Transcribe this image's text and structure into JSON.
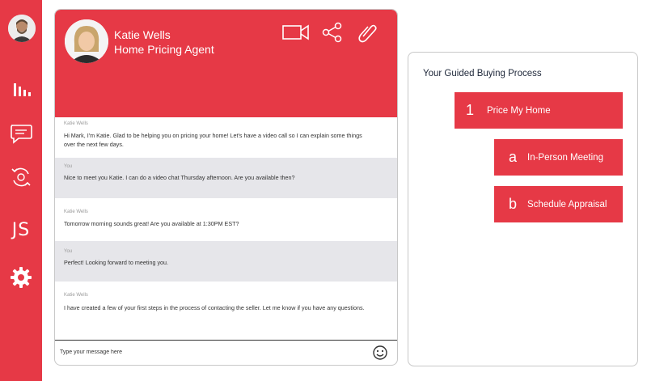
{
  "sidebar": {
    "nav": [
      "analytics-icon",
      "chat-icon",
      "sync-icon",
      "profile-initials",
      "gear-icon"
    ],
    "initials": "JS"
  },
  "chat": {
    "agent": {
      "name": "Katie Wells",
      "title": "Home Pricing Agent"
    },
    "header_icons": [
      "video-call-icon",
      "share-icon",
      "attachment-icon"
    ],
    "messages": [
      {
        "sender": "Katie Wells",
        "text": "Hi Mark, I'm Katie. Glad to be helping you on pricing your home! Let's have a video call so I can explain some things over the next few days."
      },
      {
        "sender": "You",
        "text": "Nice to meet you Katie. I can do a video chat Thursday afternoon. Are you available then?"
      },
      {
        "sender": "Katie Wells",
        "text": "Tomorrow morning sounds great! Are you available at 1:30PM EST?"
      },
      {
        "sender": "You",
        "text": "Perfect! Looking forward to meeting you."
      },
      {
        "sender": "Katie Wells",
        "text": "I have created a few of your first steps in the process of contacting the seller. Let me know if you have any questions."
      }
    ],
    "input_placeholder": "Type your message here"
  },
  "process": {
    "title": "Your Guided Buying Process",
    "steps": [
      {
        "num": "1",
        "label": "Price My Home"
      },
      {
        "num": "a",
        "label": "In-Person Meeting"
      },
      {
        "num": "b",
        "label": "Schedule Appraisal"
      }
    ]
  },
  "colors": {
    "accent": "#e63946",
    "alt_row": "#e6e6ea"
  }
}
